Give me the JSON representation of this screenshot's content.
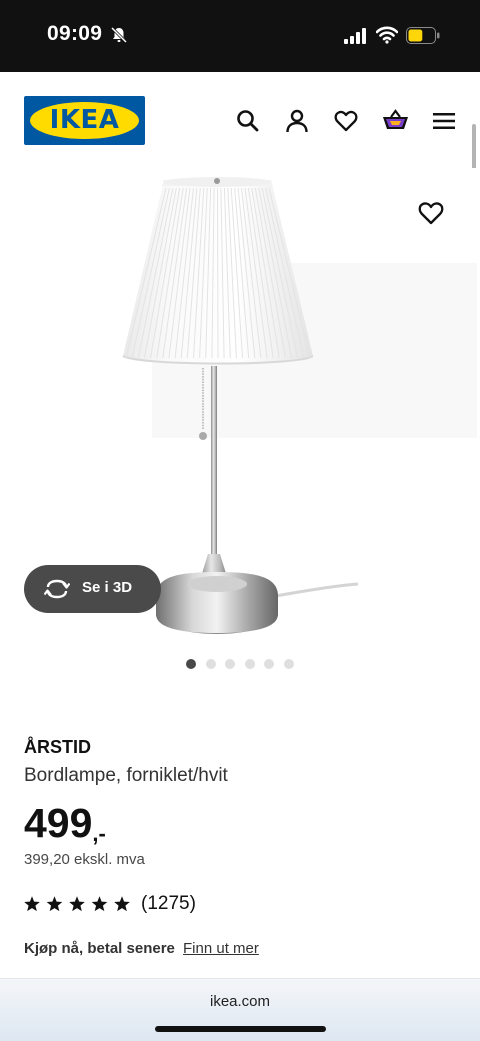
{
  "status_bar": {
    "time": "09:09",
    "icons": [
      "bell-muted-icon",
      "signal-icon",
      "wifi-icon",
      "battery-icon"
    ],
    "battery_level": 0.55
  },
  "header": {
    "logo_text": "IKEA",
    "icons": [
      "search-icon",
      "user-icon",
      "heart-icon",
      "basket-icon",
      "menu-icon"
    ]
  },
  "gallery": {
    "view_3d_label": "Se i 3D",
    "image_count": 6,
    "active_index": 0
  },
  "product": {
    "name": "ÅRSTID",
    "description": "Bordlampe, forniklet/hvit",
    "price": "499",
    "price_suffix": ",-",
    "price_ex_vat": "399,20 ekskl. mva",
    "rating_stars": 5,
    "rating_count": "(1275)",
    "buy_now_label": "Kjøp nå, betal senere",
    "find_out_more_label": "Finn ut mer"
  },
  "browser": {
    "url": "ikea.com"
  },
  "colors": {
    "ikea_blue": "#0058a3",
    "ikea_yellow": "#ffdb00",
    "button_3d_bg": "#4a4a4a"
  }
}
